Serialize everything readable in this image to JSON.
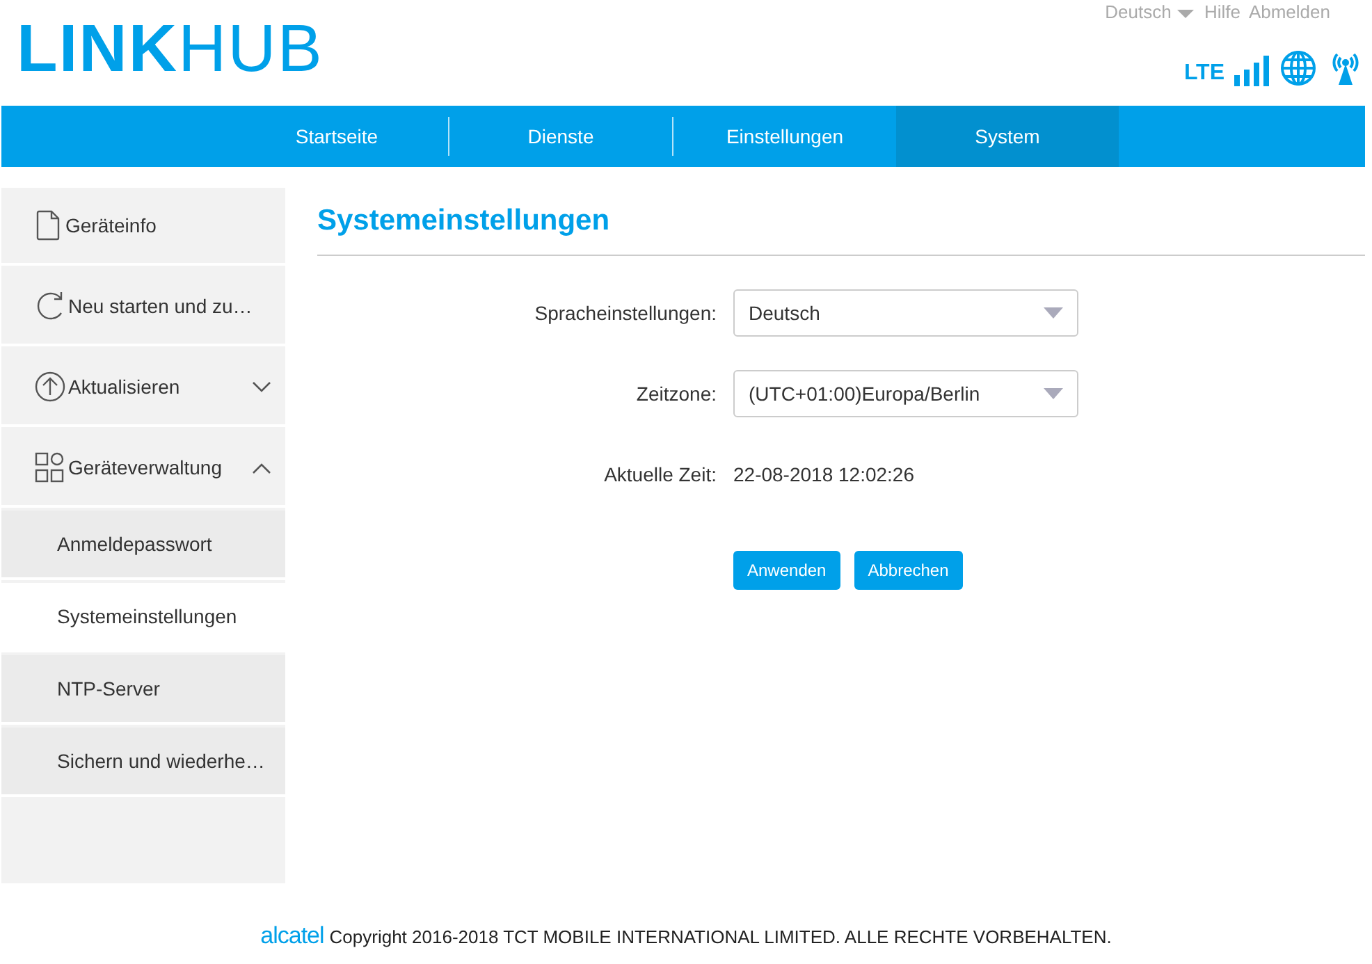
{
  "header": {
    "logo": {
      "strong": "LINK",
      "light": "HUB"
    },
    "language": "Deutsch",
    "links": [
      "Hilfe",
      "Abmelden"
    ],
    "network": "LTE"
  },
  "nav": [
    {
      "label": "Startseite",
      "selected": false
    },
    {
      "label": "Dienste",
      "selected": false
    },
    {
      "label": "Einstellungen",
      "selected": false
    },
    {
      "label": "System",
      "selected": true
    }
  ],
  "sidebar": {
    "items": [
      {
        "label": "Geräteinfo"
      },
      {
        "label": "Neu starten und zu…"
      },
      {
        "label": "Aktualisieren",
        "expanded": false
      },
      {
        "label": "Geräteverwaltung",
        "expanded": true,
        "children": [
          {
            "label": "Anmeldepasswort",
            "selected": false
          },
          {
            "label": "Systemeinstellungen",
            "selected": true
          },
          {
            "label": "NTP-Server",
            "selected": false
          },
          {
            "label": "Sichern und wiederhe…",
            "selected": false
          }
        ]
      }
    ]
  },
  "page": {
    "title": "Systemeinstellungen",
    "fields": [
      {
        "kind": "select",
        "label": "Spracheinstellungen:",
        "value": "Deutsch"
      },
      {
        "kind": "select",
        "label": "Zeitzone:",
        "value": "(UTC+01:00)Europa/Berlin"
      },
      {
        "kind": "text",
        "label": "Aktuelle Zeit:",
        "value": "22-08-2018 12:02:26"
      }
    ],
    "buttons": [
      "Anwenden",
      "Abbrechen"
    ]
  },
  "footer": {
    "brand": "alcatel",
    "text": "Copyright 2016-2018 TCT MOBILE INTERNATIONAL LIMITED. ALLE RECHTE VORBEHALTEN."
  }
}
